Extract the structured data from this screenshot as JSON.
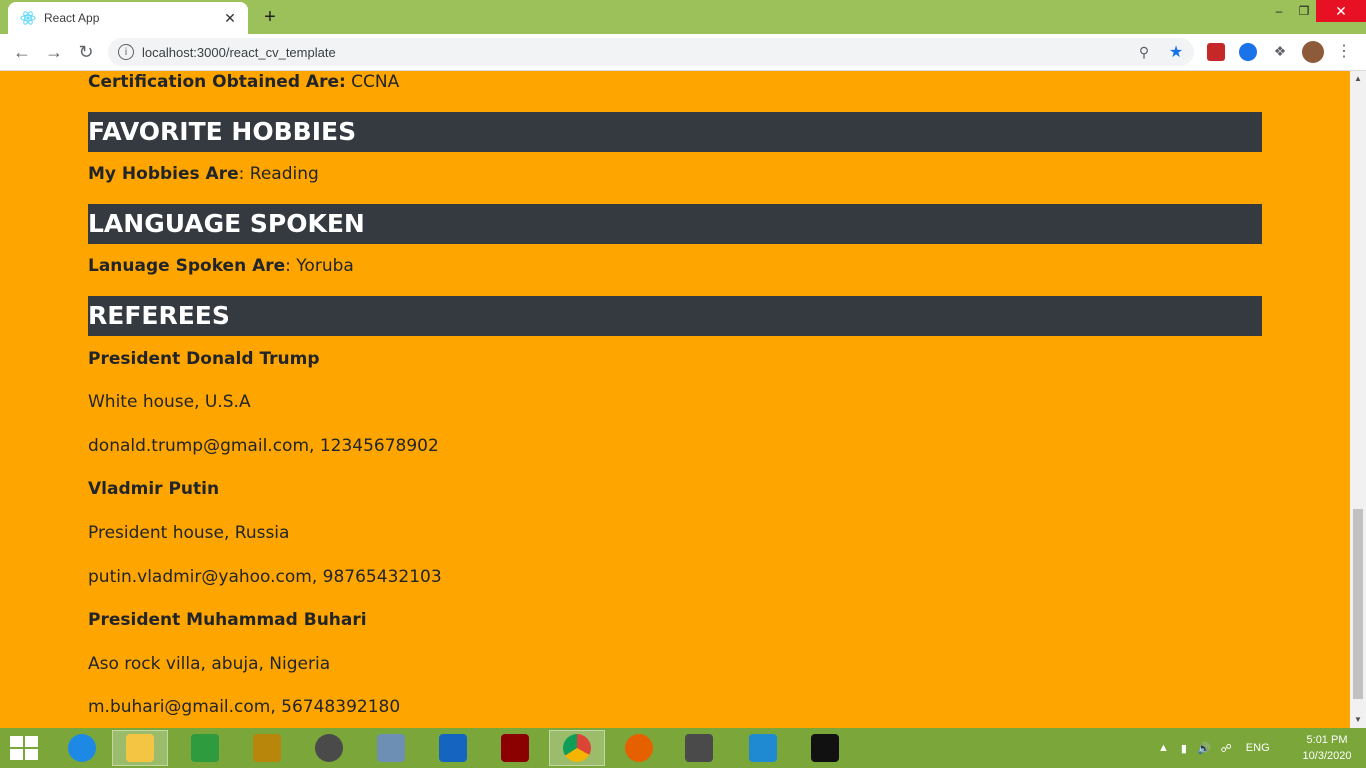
{
  "browser": {
    "tab_title": "React App",
    "tab_close": "✕",
    "new_tab": "+",
    "url": "localhost:3000/react_cv_template",
    "window_controls": {
      "minimize": "–",
      "maximize": "❐",
      "close": "✕"
    }
  },
  "cv": {
    "certification": {
      "label": "Certification Obtained Are:",
      "value": " CCNA"
    },
    "hobbies": {
      "heading": "FAVORITE HOBBIES",
      "label": "My Hobbies Are",
      "value": ": Reading"
    },
    "languages": {
      "heading": "LANGUAGE SPOKEN",
      "label": "Lanuage Spoken Are",
      "value": ": Yoruba"
    },
    "referees": {
      "heading": "REFEREES",
      "items": [
        {
          "name": "President Donald Trump",
          "address": "White house, U.S.A",
          "contact": "donald.trump@gmail.com, 12345678902"
        },
        {
          "name": "Vladmir Putin",
          "address": "President house, Russia",
          "contact": "putin.vladmir@yahoo.com, 98765432103"
        },
        {
          "name": "President Muhammad Buhari",
          "address": "Aso rock villa, abuja, Nigeria",
          "contact": "m.buhari@gmail.com, 56748392180"
        }
      ]
    }
  },
  "taskbar": {
    "language": "ENG",
    "time": "5:01 PM",
    "date": "10/3/2020",
    "apps": [
      "internet-explorer-icon",
      "file-explorer-icon",
      "store-icon",
      "app-icon",
      "speaker-app-icon",
      "doc-icon",
      "settings-app-icon",
      "power-icon",
      "chrome-icon",
      "firefox-icon",
      "sublime-icon",
      "vscode-icon",
      "cmd-icon"
    ]
  },
  "colors": {
    "page_background": "#ffa500",
    "section_header": "#343a40",
    "tabstrip": "#9cc15a",
    "taskbar": "#7aa63a"
  }
}
